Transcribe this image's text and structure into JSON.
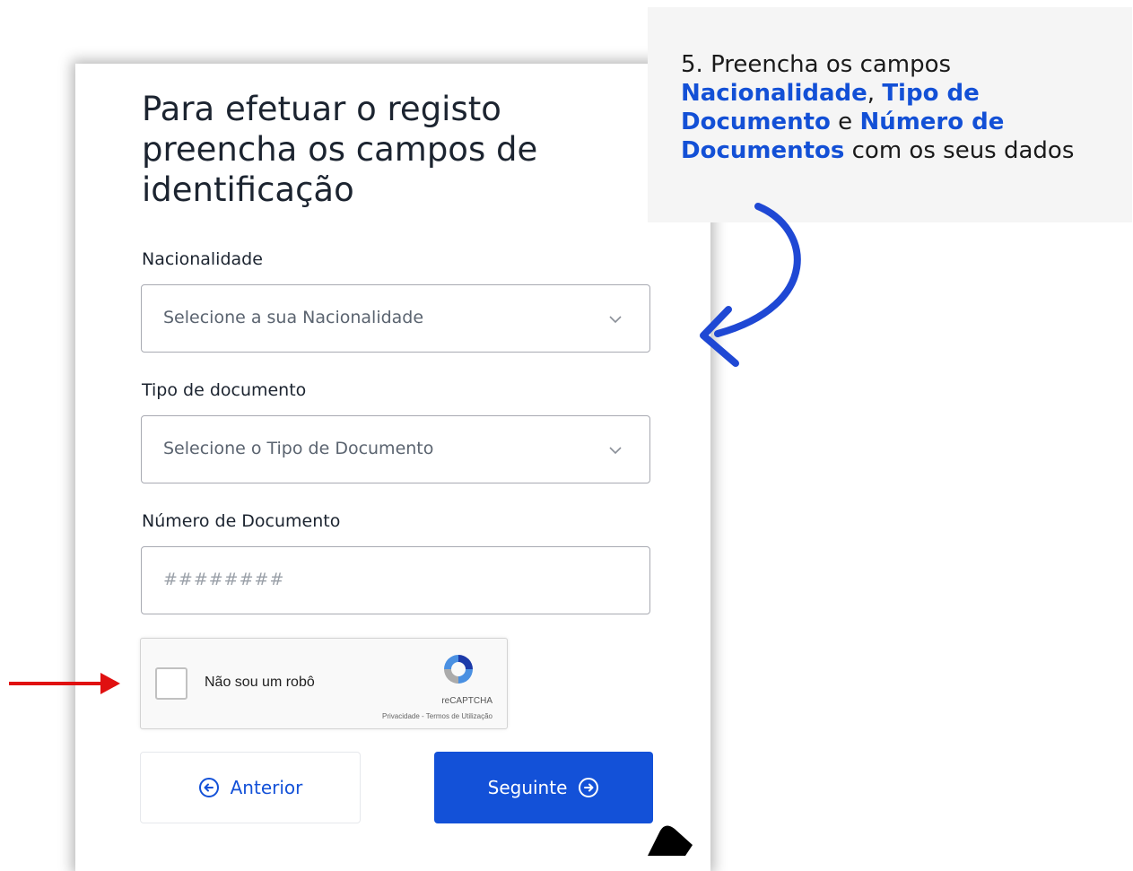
{
  "form": {
    "title": "Para efetuar o registo preencha os campos de identificação",
    "nationality": {
      "label": "Nacionalidade",
      "placeholder": "Selecione a sua Nacionalidade"
    },
    "doc_type": {
      "label": "Tipo de documento",
      "placeholder": "Selecione o Tipo de Documento"
    },
    "doc_number": {
      "label": "Número de Documento",
      "placeholder": "########"
    },
    "captcha": {
      "label": "Não sou um robô",
      "brand": "reCAPTCHA",
      "terms": "Privacidade - Termos de Utilização"
    },
    "prev_label": "Anterior",
    "next_label": "Seguinte"
  },
  "callout": {
    "p1": "5. Preencha  os campos ",
    "h1": "Nacionalidade",
    "p2": ", ",
    "h2": "Tipo de Documento",
    "p3": "  e ",
    "h3": "Número de Documentos",
    "p4": " com os seus dados"
  },
  "colors": {
    "accent": "#1351d8",
    "highlight": "#1350d6",
    "arrow_red": "#e01010",
    "arrow_blue": "#1f48d4"
  },
  "icons": [
    "chevron-down-icon",
    "arrow-left-circle-icon",
    "arrow-right-circle-icon",
    "recaptcha-logo-icon"
  ]
}
